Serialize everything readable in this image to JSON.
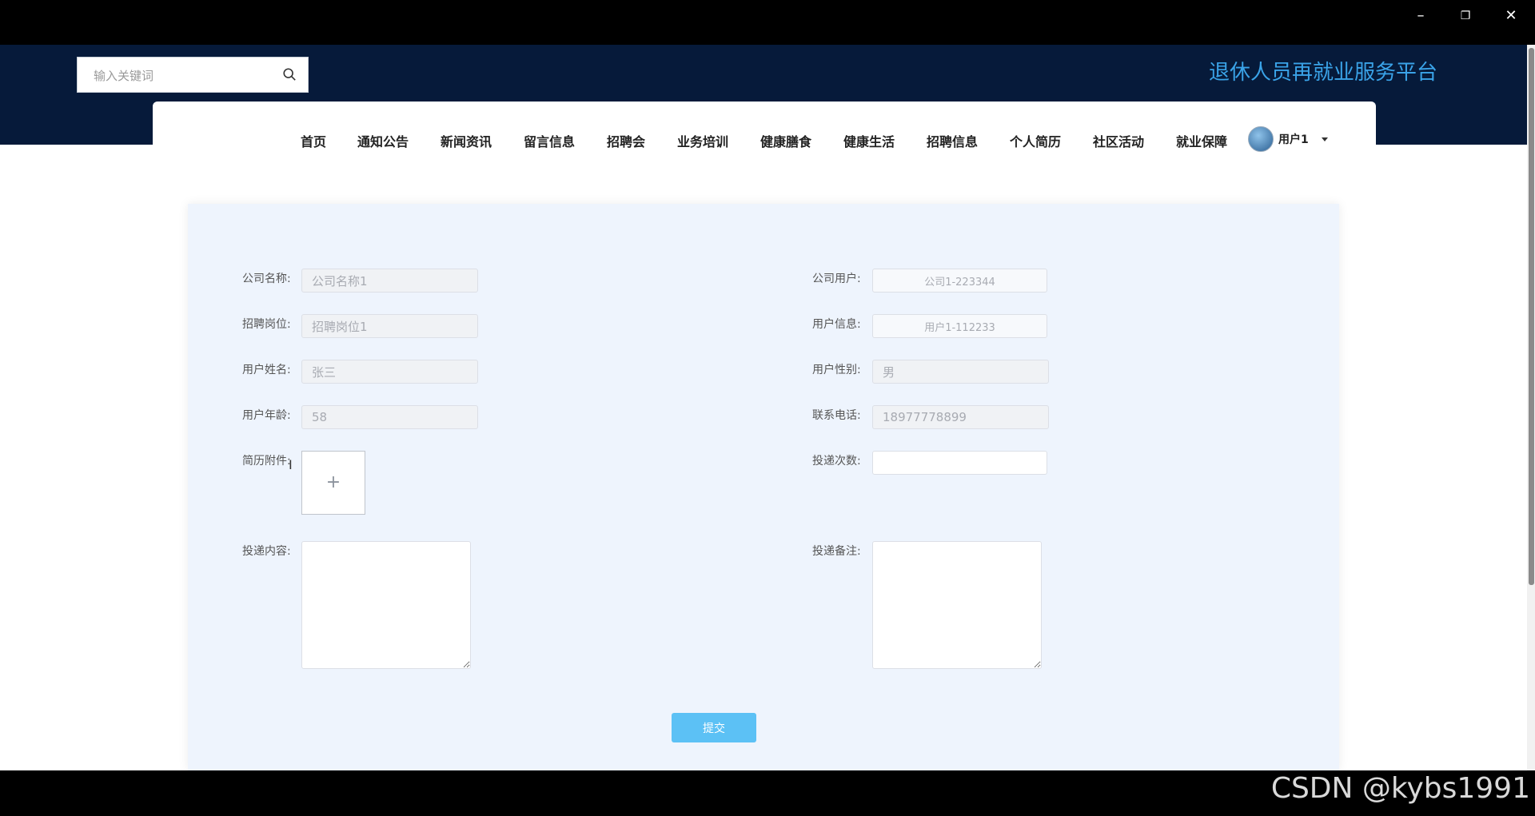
{
  "window_controls": {
    "minimize": "–",
    "restore": "❐",
    "close": "✕"
  },
  "header": {
    "search_placeholder": "输入关键词",
    "site_title": "退休人员再就业服务平台"
  },
  "nav": {
    "items": [
      "首页",
      "通知公告",
      "新闻资讯",
      "留言信息",
      "招聘会",
      "业务培训",
      "健康膳食",
      "健康生活",
      "招聘信息",
      "个人简历",
      "社区活动",
      "就业保障"
    ],
    "user_name": "用户1"
  },
  "form": {
    "company_name": {
      "label": "公司名称:",
      "value": "公司名称1"
    },
    "company_user": {
      "label": "公司用户:",
      "value": "公司1-223344"
    },
    "job_position": {
      "label": "招聘岗位:",
      "value": "招聘岗位1"
    },
    "user_info": {
      "label": "用户信息:",
      "value": "用户1-112233"
    },
    "user_name": {
      "label": "用户姓名:",
      "value": "张三"
    },
    "user_gender": {
      "label": "用户性别:",
      "value": "男"
    },
    "user_age": {
      "label": "用户年龄:",
      "value": "58"
    },
    "phone": {
      "label": "联系电话:",
      "value": "18977778899"
    },
    "resume_attachment": {
      "label": "简历附件:",
      "upload_glyph": "+"
    },
    "delivery_count": {
      "label": "投递次数:",
      "value": ""
    },
    "delivery_content": {
      "label": "投递内容:",
      "value": ""
    },
    "delivery_note": {
      "label": "投递备注:",
      "value": ""
    },
    "submit_label": "提交"
  },
  "watermark": "CSDN @kybs1991"
}
